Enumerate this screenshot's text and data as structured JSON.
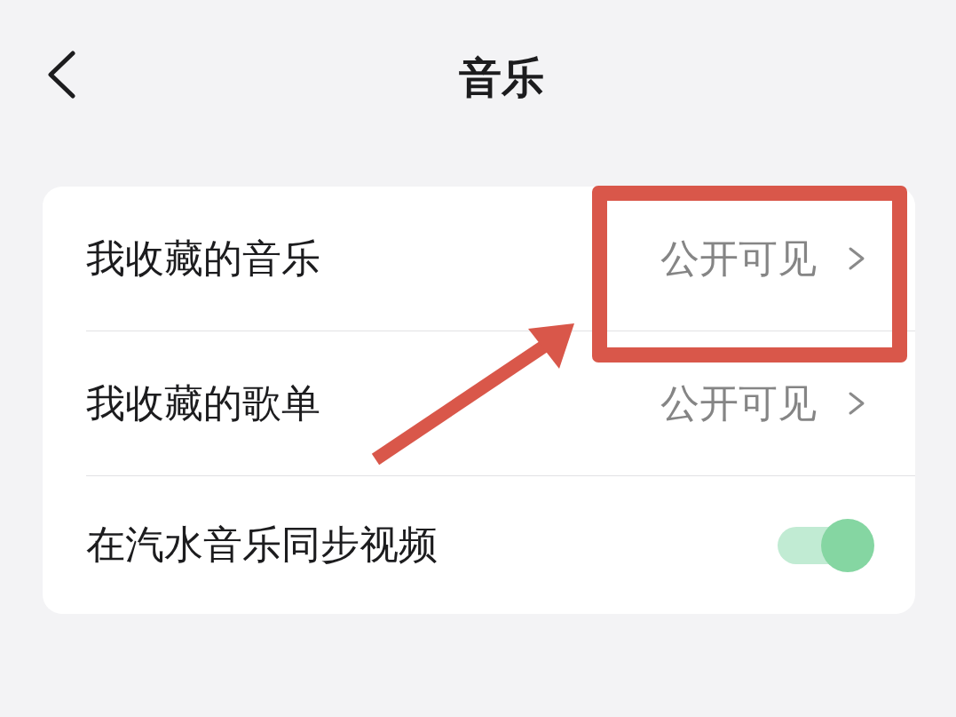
{
  "header": {
    "title": "音乐"
  },
  "rows": [
    {
      "kind": "link",
      "label": "我收藏的音乐",
      "value": "公开可见",
      "highlighted": true
    },
    {
      "kind": "link",
      "label": "我收藏的歌单",
      "value": "公开可见",
      "highlighted": false
    },
    {
      "kind": "toggle",
      "label": "在汽水音乐同步视频",
      "on": true
    }
  ]
}
